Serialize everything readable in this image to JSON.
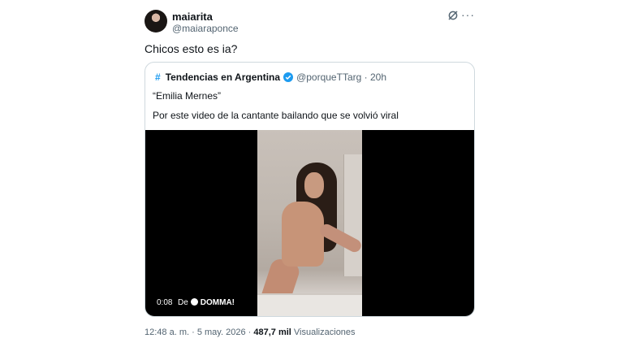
{
  "author": {
    "display_name": "maiarita",
    "handle": "@maiaraponce"
  },
  "post": {
    "text": "Chicos esto es ia?"
  },
  "quote": {
    "name": "Tendencias en Argentina",
    "handle": "@porqueTTarg",
    "separator": "·",
    "time": "20h",
    "line1": "“Emilia Mernes”",
    "line2": "Por este video de la cantante bailando que se volvió viral"
  },
  "video": {
    "time": "0:08",
    "source_prefix": "De",
    "source_name": "DOMMA!"
  },
  "meta": {
    "time": "12:48 a. m.",
    "separator": "·",
    "date": "5 may. 2026",
    "separator2": "·",
    "views_count": "487,7 mil",
    "views_label": "Visualizaciones"
  },
  "icons": {
    "grok": "grok-icon",
    "more": "more-icon",
    "hashtag": "hash-icon",
    "verified": "verified-icon"
  },
  "colors": {
    "accent": "#1d9bf0",
    "text": "#0f1419",
    "muted": "#536471",
    "border": "#cfd9de"
  }
}
